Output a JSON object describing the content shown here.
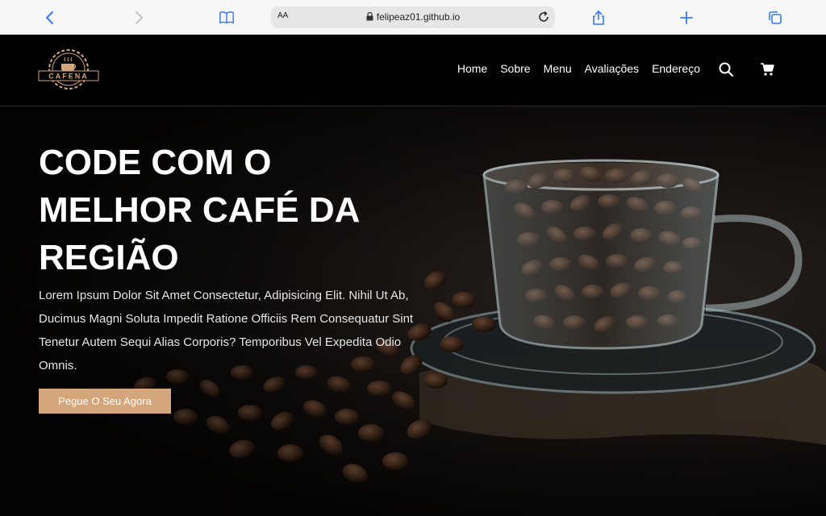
{
  "browser": {
    "url": "felipeaz01.github.io",
    "text_size_label": "AA"
  },
  "brand": {
    "logo_text": "CAFENA",
    "accent_color": "#d3a67c"
  },
  "nav": {
    "items": [
      {
        "label": "Home"
      },
      {
        "label": "Sobre"
      },
      {
        "label": "Menu"
      },
      {
        "label": "Avaliações"
      },
      {
        "label": "Endereço"
      }
    ]
  },
  "hero": {
    "title": "CODE COM O MELHOR CAFÉ DA REGIÃO",
    "text": "Lorem Ipsum Dolor Sit Amet Consectetur, Adipisicing Elit. Nihil Ut Ab, Ducimus Magni Soluta Impedit Ratione Officiis Rem Consequatur Sint Tenetur Autem Sequi Alias Corporis? Temporibus Vel Expedita Odio Omnis.",
    "cta_label": "Pegue O Seu Agora"
  }
}
